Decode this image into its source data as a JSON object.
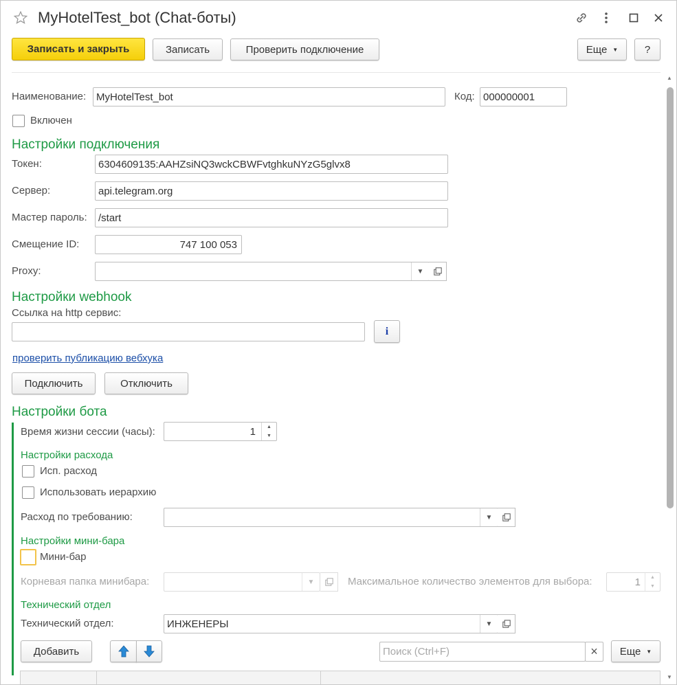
{
  "window": {
    "title": "MyHotelTest_bot (Chat-боты)"
  },
  "toolbar": {
    "save_close": "Записать и закрыть",
    "save": "Записать",
    "check_connection": "Проверить подключение",
    "more": "Еще",
    "help": "?"
  },
  "main": {
    "name_label": "Наименование:",
    "name_value": "MyHotelTest_bot",
    "code_label": "Код:",
    "code_value": "000000001",
    "enabled_label": "Включен"
  },
  "connection": {
    "header": "Настройки подключения",
    "token_label": "Токен:",
    "token_value": "6304609135:AAHZsiNQ3wckCBWFvtghkuNYzG5glvx8",
    "server_label": "Сервер:",
    "server_value": "api.telegram.org",
    "master_label": "Мастер пароль:",
    "master_value": "/start",
    "offset_label": "Смещение ID:",
    "offset_value": "747 100 053",
    "proxy_label": "Proxy:",
    "proxy_value": ""
  },
  "webhook": {
    "header": "Настройки webhook",
    "url_label": "Ссылка на http сервис:",
    "url_value": "",
    "info": "i",
    "check_link": "проверить публикацию вебхука",
    "connect": "Подключить",
    "disconnect": "Отключить"
  },
  "bot": {
    "header": "Настройки бота",
    "session_label": "Время жизни сессии (часы):",
    "session_value": "1",
    "expense_header": "Настройки расхода",
    "use_expense": "Исп. расход",
    "use_hierarchy": "Использовать иерархию",
    "expense_req_label": "Расход по требованию:",
    "expense_req_value": "",
    "minibar_header": "Настройки мини-бара",
    "minibar_label": "Мини-бар",
    "minibar_root_label": "Корневая папка минибара:",
    "minibar_root_value": "",
    "max_items_label": "Максимальное количество элементов для выбора:",
    "max_items_value": "1",
    "tech_header": "Технический отдел",
    "tech_label": "Технический отдел:",
    "tech_value": "ИНЖЕНЕРЫ",
    "add": "Добавить",
    "search_placeholder": "Поиск (Ctrl+F)",
    "clear": "×",
    "more": "Еще"
  },
  "colors": {
    "accent_green": "#1e9a45",
    "primary_button": "#f5cf0a",
    "link": "#1c4fa8",
    "arrow_blue": "#2a8ad6"
  }
}
